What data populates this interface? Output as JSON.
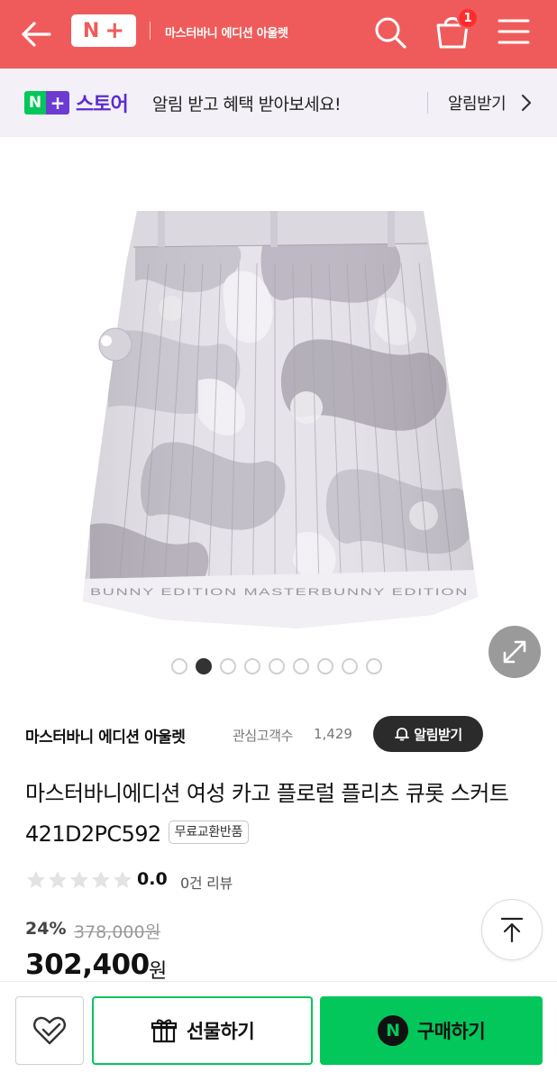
{
  "header": {
    "logo_n": "N",
    "logo_plus": "+",
    "store_title": "마스터바니 에디션 아울렛",
    "cart_count": "1",
    "background": "#ef5b5b"
  },
  "banner": {
    "logo_n": "N",
    "logo_plus": "+",
    "store_label": "스토어",
    "message": "알림 받고 혜택 받아보세요!",
    "action": "알림받기"
  },
  "gallery": {
    "image": "pleated-floral-camo-skirt-photo",
    "text_on_image": "BUNNY EDITION MASTERBUNNY EDITION",
    "slide_count": 9,
    "active_slide": 2
  },
  "store": {
    "name": "마스터바니 에디션 아울렛",
    "interest_label": "관심고객수",
    "interest_count": "1,429",
    "alarm_button": "알림받기"
  },
  "product": {
    "title": "마스터바니에디션 여성 카고 플로럴 플리츠 큐롯 스커트 421D2PC592",
    "tag": "무료교환반품",
    "rating": "0.0",
    "stars_filled": 0,
    "stars_total": 5,
    "review_count": "0건 리뷰",
    "discount": "24%",
    "original_price": "378,000원",
    "price": "302,400",
    "currency": "원"
  },
  "actions": {
    "wish_icon": "heart-check-icon",
    "gift_label": "선물하기",
    "buy_label": "구매하기",
    "npay_letter": "N",
    "buy_color": "#03c75a"
  }
}
